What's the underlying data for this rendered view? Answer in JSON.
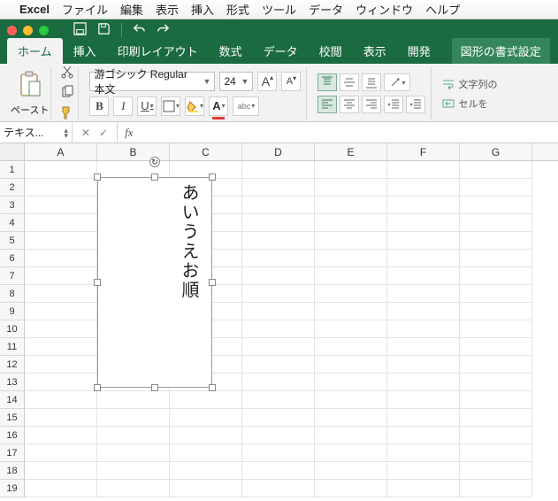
{
  "mac_menu": {
    "apple": "",
    "app": "Excel",
    "items": [
      "ファイル",
      "編集",
      "表示",
      "挿入",
      "形式",
      "ツール",
      "データ",
      "ウィンドウ",
      "ヘルプ"
    ]
  },
  "qat": {
    "save_icon": "save-icon",
    "undo_icon": "undo-icon",
    "redo_icon": "redo-icon"
  },
  "ribbon_tabs": {
    "tabs": [
      "ホーム",
      "挿入",
      "印刷レイアウト",
      "数式",
      "データ",
      "校閲",
      "表示",
      "開発"
    ],
    "active_index": 0,
    "context_tab": "図形の書式設定"
  },
  "ribbon": {
    "paste_label": "ペースト",
    "font_name": "游ゴシック Regular 本文",
    "font_size": "24",
    "incfont": "A",
    "decfont": "A",
    "bold": "B",
    "italic": "I",
    "underline": "U",
    "ruby_label": "ab",
    "fontcolor_letter": "A",
    "fillcolor_letter": "A",
    "wrap_label": "文字列の",
    "merge_label": "セルを"
  },
  "formula_bar": {
    "name_box": "テキス...",
    "fx_label": "fx",
    "formula_value": ""
  },
  "grid": {
    "columns": [
      "A",
      "B",
      "C",
      "D",
      "E",
      "F",
      "G"
    ],
    "row_count": 19
  },
  "shape": {
    "text": "あいうえお順"
  }
}
